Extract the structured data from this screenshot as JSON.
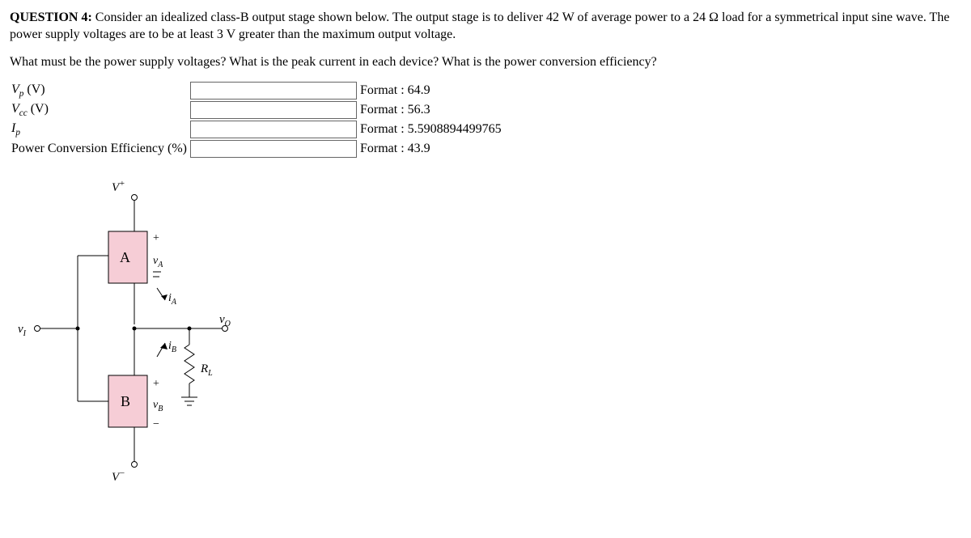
{
  "question": {
    "label": "QUESTION 4:",
    "intro": " Consider an idealized class-B output stage shown below. The output stage is to deliver 42 W of average power to a 24 Ω load for a symmetrical input sine wave. The power supply voltages are to be at least 3 V greater than the maximum output voltage.",
    "sub": "What must be the power supply voltages? What is the peak current in each device? What is the power conversion efficiency?"
  },
  "rows": [
    {
      "sym": "V",
      "sub": "p",
      "unit": " (V)",
      "format": "Format : 64.9"
    },
    {
      "sym": "V",
      "sub": "cc",
      "unit": " (V)",
      "format": "Format : 56.3"
    },
    {
      "sym": "I",
      "sub": "p",
      "unit": "",
      "format": "Format : 5.5908894499765"
    },
    {
      "plain": "Power Conversion Efficiency (%)",
      "format": "Format : 43.9"
    }
  ],
  "circuit": {
    "vplus": "V",
    "vplus_sup": "+",
    "vminus": "V",
    "vminus_sup": "−",
    "vi": "v",
    "vi_sub": "I",
    "A": "A",
    "B": "B",
    "vA": "v",
    "vA_sub": "A",
    "vB": "v",
    "vB_sub": "B",
    "iA": "i",
    "iA_sub": "A",
    "iB": "i",
    "iB_sub": "B",
    "RL": "R",
    "RL_sub": "L",
    "vo": "v",
    "vo_sub": "O",
    "plus": "+",
    "minus": "−"
  }
}
